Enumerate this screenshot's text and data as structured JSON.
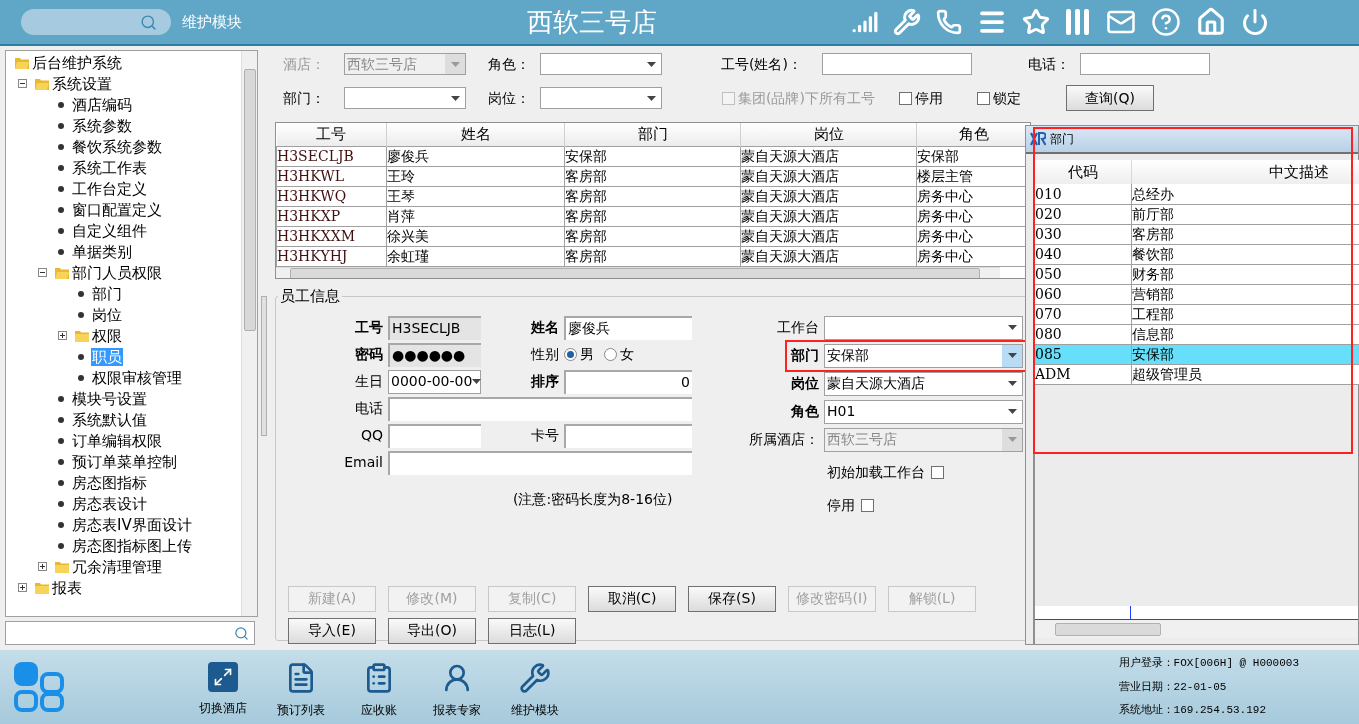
{
  "header": {
    "module": "维护模块",
    "title": "西软三号店"
  },
  "tree": {
    "items": [
      {
        "label": "后台维护系统",
        "kind": "folder",
        "expanded": true,
        "selected": false,
        "children": [
          {
            "label": "系统设置",
            "kind": "folder",
            "expanded": true,
            "selected": false,
            "children": [
              {
                "label": "酒店编码",
                "kind": "leaf",
                "selected": false
              },
              {
                "label": "系统参数",
                "kind": "leaf",
                "selected": false
              },
              {
                "label": "餐饮系统参数",
                "kind": "leaf",
                "selected": false
              },
              {
                "label": "系统工作表",
                "kind": "leaf",
                "selected": false
              },
              {
                "label": "工作台定义",
                "kind": "leaf",
                "selected": false
              },
              {
                "label": "窗口配置定义",
                "kind": "leaf",
                "selected": false
              },
              {
                "label": "自定义组件",
                "kind": "leaf",
                "selected": false
              },
              {
                "label": "单据类别",
                "kind": "leaf",
                "selected": false
              },
              {
                "label": "部门人员权限",
                "kind": "folder",
                "expanded": true,
                "selected": false,
                "children": [
                  {
                    "label": "部门",
                    "kind": "leaf",
                    "selected": false
                  },
                  {
                    "label": "岗位",
                    "kind": "leaf",
                    "selected": false
                  },
                  {
                    "label": "权限",
                    "kind": "folder",
                    "expanded": false,
                    "selected": false
                  },
                  {
                    "label": "职员",
                    "kind": "leaf",
                    "selected": true
                  },
                  {
                    "label": "权限审核管理",
                    "kind": "leaf",
                    "selected": false
                  }
                ]
              },
              {
                "label": "模块号设置",
                "kind": "leaf",
                "selected": false
              },
              {
                "label": "系统默认值",
                "kind": "leaf",
                "selected": false
              },
              {
                "label": "订单编辑权限",
                "kind": "leaf",
                "selected": false
              },
              {
                "label": "预订单菜单控制",
                "kind": "leaf",
                "selected": false
              },
              {
                "label": "房态图指标",
                "kind": "leaf",
                "selected": false
              },
              {
                "label": "房态表设计",
                "kind": "leaf",
                "selected": false
              },
              {
                "label": "房态表IV界面设计",
                "kind": "leaf",
                "selected": false
              },
              {
                "label": "房态图指标图上传",
                "kind": "leaf",
                "selected": false
              },
              {
                "label": "冗余清理管理",
                "kind": "folder",
                "expanded": false,
                "selected": false
              }
            ]
          },
          {
            "label": "报表",
            "kind": "folder",
            "expanded": false,
            "selected": false
          }
        ]
      }
    ]
  },
  "filter_rows": [
    [
      {
        "kind": "combo",
        "label": "酒店：",
        "value": "西软三号店",
        "disabled": true
      },
      {
        "kind": "combo",
        "label": "角色：",
        "disabled": false
      },
      {
        "kind": "input",
        "label": "工号(姓名)：",
        "disabled": false
      },
      {
        "kind": "input",
        "label": "电话：",
        "disabled": false
      }
    ],
    [
      {
        "kind": "combo",
        "label": "部门：",
        "disabled": false
      },
      {
        "kind": "combo",
        "label": "岗位：",
        "disabled": false
      },
      {
        "kind": "checkbox",
        "label": "集团(品牌)下所有工号",
        "checked": false,
        "disabled": true
      },
      {
        "kind": "checkbox",
        "label": "停用",
        "checked": false,
        "disabled": false
      },
      {
        "kind": "checkbox",
        "label": "锁定",
        "checked": false,
        "disabled": false
      },
      {
        "kind": "button",
        "label": "查询(Q)",
        "disabled": false
      }
    ]
  ],
  "table": {
    "columns": [
      "工号",
      "姓名",
      "部门",
      "岗位",
      "角色"
    ],
    "rows": [
      {
        "cells": [
          "H3SECLJB",
          "廖俊兵",
          "安保部",
          "蒙自天源大酒店",
          "安保部"
        ]
      },
      {
        "cells": [
          "H3HKWL",
          "王玲",
          "客房部",
          "蒙自天源大酒店",
          "楼层主管"
        ]
      },
      {
        "cells": [
          "H3HKWQ",
          "王琴",
          "客房部",
          "蒙自天源大酒店",
          "房务中心"
        ]
      },
      {
        "cells": [
          "H3HKXP",
          "肖萍",
          "客房部",
          "蒙自天源大酒店",
          "房务中心"
        ]
      },
      {
        "cells": [
          "H3HKXXM",
          "徐兴美",
          "客房部",
          "蒙自天源大酒店",
          "房务中心"
        ]
      },
      {
        "cells": [
          "H3HKYHJ",
          "余虹瑾",
          "客房部",
          "蒙自天源大酒店",
          "房务中心"
        ]
      }
    ]
  },
  "employee_form": {
    "title": "员工信息",
    "left_rows": [
      [
        {
          "kind": "text",
          "label": "工号",
          "value": "H3SECLJB",
          "required": true,
          "readonly": true
        },
        {
          "kind": "text",
          "label": "姓名",
          "value": "廖俊兵",
          "required": true,
          "readonly": false
        }
      ],
      [
        {
          "kind": "text",
          "label": "密码",
          "value": "●●●●●●",
          "required": true,
          "readonly": true
        },
        {
          "kind": "radio",
          "label": "性别",
          "required": false,
          "options": [
            {
              "label": "男",
              "selected": true
            },
            {
              "label": "女",
              "selected": false
            }
          ]
        }
      ],
      [
        {
          "kind": "combo",
          "label": "生日",
          "value": "0000-00-00",
          "required": false
        },
        {
          "kind": "number",
          "label": "排序",
          "value": "0",
          "required": true,
          "readonly": false
        }
      ],
      [
        {
          "kind": "text",
          "label": "电话",
          "required": false,
          "readonly": false
        }
      ],
      [
        {
          "kind": "text",
          "label": "QQ",
          "required": false,
          "readonly": false
        },
        {
          "kind": "text",
          "label": "卡号",
          "required": false,
          "readonly": false
        }
      ],
      [
        {
          "kind": "text",
          "label": "Email",
          "required": false,
          "readonly": false
        }
      ]
    ],
    "note": "(注意:密码长度为8-16位)",
    "right_rows": [
      {
        "kind": "combo",
        "label": "工作台",
        "required": false,
        "disabled": false,
        "focused": false
      },
      {
        "kind": "combo",
        "label": "部门",
        "value": "安保部",
        "required": true,
        "disabled": false,
        "focused": true
      },
      {
        "kind": "combo",
        "label": "岗位",
        "value": "蒙自天源大酒店",
        "required": true,
        "disabled": false,
        "focused": false
      },
      {
        "kind": "combo",
        "label": "角色",
        "value": "H01",
        "required": true,
        "disabled": false,
        "focused": false
      },
      {
        "kind": "combo",
        "label": "所属酒店：",
        "value": "西软三号店",
        "required": false,
        "disabled": true,
        "focused": false
      },
      {
        "kind": "checkbox",
        "label": "初始加载工作台",
        "checked": false
      },
      {
        "kind": "checkbox",
        "label": "停用",
        "checked": false
      }
    ]
  },
  "buttons": [
    [
      {
        "label": "新建(A)",
        "disabled": true
      },
      {
        "label": "修改(M)",
        "disabled": true
      },
      {
        "label": "复制(C)",
        "disabled": true
      },
      {
        "label": "取消(C)",
        "disabled": false
      },
      {
        "label": "保存(S)",
        "disabled": false
      },
      {
        "label": "修改密码(I)",
        "disabled": true
      },
      {
        "label": "解锁(L)",
        "disabled": true
      }
    ],
    [
      {
        "label": "导入(E)",
        "disabled": false
      },
      {
        "label": "导出(O)",
        "disabled": false
      },
      {
        "label": "日志(L)",
        "disabled": false
      }
    ]
  ],
  "popup": {
    "title": "部门",
    "columns": [
      "代码",
      "中文描述"
    ],
    "rows": [
      {
        "cells": [
          "010",
          "总经办"
        ],
        "selected": false
      },
      {
        "cells": [
          "020",
          "前厅部"
        ],
        "selected": false
      },
      {
        "cells": [
          "030",
          "客房部"
        ],
        "selected": false
      },
      {
        "cells": [
          "040",
          "餐饮部"
        ],
        "selected": false
      },
      {
        "cells": [
          "050",
          "财务部"
        ],
        "selected": false
      },
      {
        "cells": [
          "060",
          "营销部"
        ],
        "selected": false
      },
      {
        "cells": [
          "070",
          "工程部"
        ],
        "selected": false
      },
      {
        "cells": [
          "080",
          "信息部"
        ],
        "selected": false
      },
      {
        "cells": [
          "085",
          "安保部"
        ],
        "selected": true
      },
      {
        "cells": [
          "ADM",
          "超级管理员"
        ],
        "selected": false
      }
    ]
  },
  "taskbar": {
    "items": [
      {
        "label": "切换酒店",
        "kind": "switch"
      },
      {
        "label": "预订列表",
        "kind": "list"
      },
      {
        "label": "应收账",
        "kind": "ledger"
      },
      {
        "label": "报表专家",
        "kind": "expert"
      },
      {
        "label": "维护模块",
        "kind": "tools"
      }
    ],
    "status": [
      {
        "label": "用户登录：",
        "value": "FOX[006H] @ H000003"
      },
      {
        "label": "营业日期：",
        "value": "22-01-05"
      },
      {
        "label": "系统地址：",
        "value": "169.254.53.192"
      }
    ]
  }
}
